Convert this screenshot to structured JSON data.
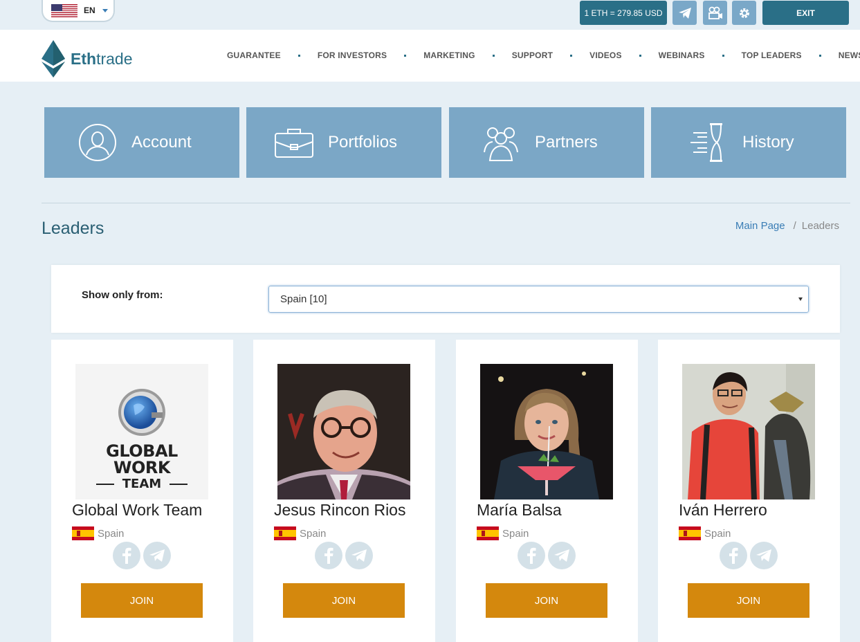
{
  "topbar": {
    "lang_code": "EN",
    "price": "1 ETH = 279.85 USD",
    "exit_label": "EXIT"
  },
  "brand": {
    "part1": "Eth",
    "part2": "trade"
  },
  "nav": {
    "items": [
      "GUARANTEE",
      "FOR INVESTORS",
      "MARKETING",
      "SUPPORT",
      "VIDEOS",
      "WEBINARS",
      "TOP LEADERS",
      "NEWS"
    ]
  },
  "tiles": [
    {
      "label": "Account",
      "icon": "user-circle-icon"
    },
    {
      "label": "Portfolios",
      "icon": "briefcase-icon"
    },
    {
      "label": "Partners",
      "icon": "people-group-icon"
    },
    {
      "label": "History",
      "icon": "hourglass-icon"
    }
  ],
  "page": {
    "title": "Leaders",
    "breadcrumb": {
      "home": "Main Page",
      "current": "Leaders"
    }
  },
  "filter": {
    "label": "Show only from:",
    "selected": "Spain [10]"
  },
  "leaders": [
    {
      "name": "Global Work Team",
      "country": "Spain",
      "join": "JOIN",
      "logo_line1": "GLOBAL WORK",
      "logo_line2": "TEAM"
    },
    {
      "name": "Jesus Rincon Rios",
      "country": "Spain",
      "join": "JOIN"
    },
    {
      "name": "María Balsa",
      "country": "Spain",
      "join": "JOIN"
    },
    {
      "name": "Iván Herrero",
      "country": "Spain",
      "join": "JOIN"
    }
  ],
  "colors": {
    "primary": "#2a6f87",
    "tile": "#7ba7c6",
    "join": "#d4880d",
    "background": "#e6eff5"
  }
}
